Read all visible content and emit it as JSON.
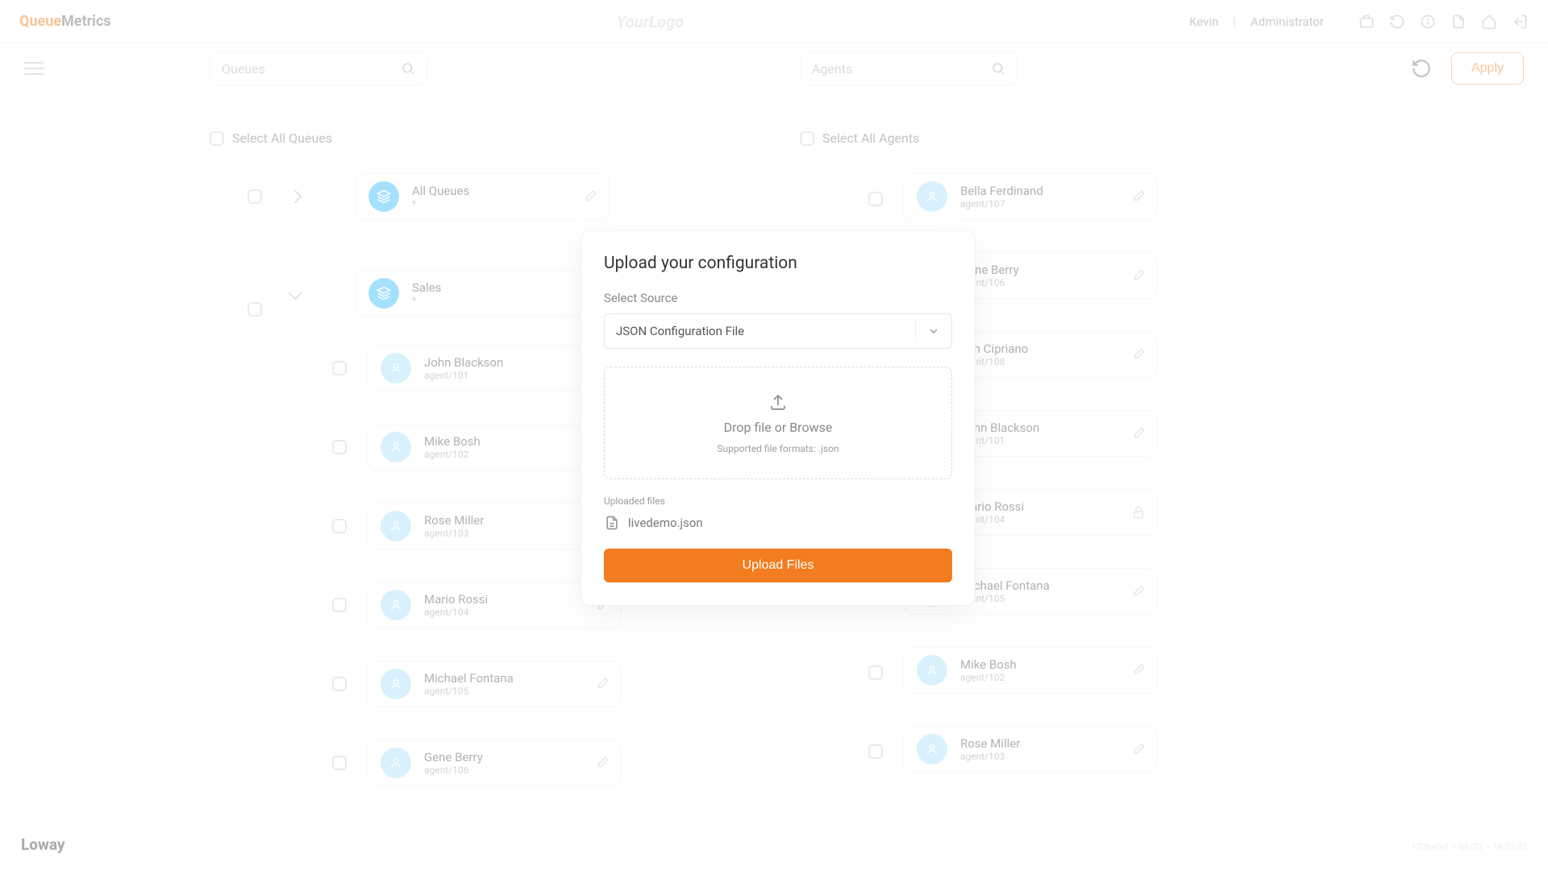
{
  "brand": {
    "part1": "Queue",
    "part2": "Metrics"
  },
  "centerLogo": "YourLogo",
  "user": {
    "name": "Kevin",
    "role": "Administrator"
  },
  "search": {
    "queues_ph": "Queues",
    "agents_ph": "Agents"
  },
  "apply_label": "Apply",
  "selectall": {
    "queues": "Select All Queues",
    "agents": "Select All Agents"
  },
  "queues": [
    {
      "name": "All Queues",
      "sub": "*"
    },
    {
      "name": "Sales",
      "sub": "*"
    }
  ],
  "sub_agents": [
    {
      "name": "John Blackson",
      "ext": "agent/101"
    },
    {
      "name": "Mike Bosh",
      "ext": "agent/102"
    },
    {
      "name": "Rose Miller",
      "ext": "agent/103"
    },
    {
      "name": "Mario Rossi",
      "ext": "agent/104"
    },
    {
      "name": "Michael Fontana",
      "ext": "agent/105"
    },
    {
      "name": "Gene Berry",
      "ext": "agent/106"
    }
  ],
  "agents": [
    {
      "name": "Bella Ferdinand",
      "ext": "agent/107",
      "locked": false
    },
    {
      "name": "Gene Berry",
      "ext": "agent/106",
      "locked": false
    },
    {
      "name": "Jim Cipriano",
      "ext": "agent/108",
      "locked": false
    },
    {
      "name": "John Blackson",
      "ext": "agent/101",
      "locked": false
    },
    {
      "name": "Mario Rossi",
      "ext": "agent/104",
      "locked": true
    },
    {
      "name": "Michael Fontana",
      "ext": "agent/105",
      "locked": false
    },
    {
      "name": "Mike Bosh",
      "ext": "agent/102",
      "locked": false
    },
    {
      "name": "Rose Miller",
      "ext": "agent/103",
      "locked": false
    }
  ],
  "modal": {
    "title": "Upload your configuration",
    "source_label": "Select Source",
    "source_value": "JSON Configuration File",
    "drop_text": "Drop file or Browse",
    "drop_sub": "Supported file formats: .json",
    "uploaded_label": "Uploaded files",
    "uploaded_file": "livedemo.json",
    "button": "Upload Files"
  },
  "footer": {
    "logo": "Loway",
    "build": "170beta1 – 09/23 – 16:03:02"
  }
}
